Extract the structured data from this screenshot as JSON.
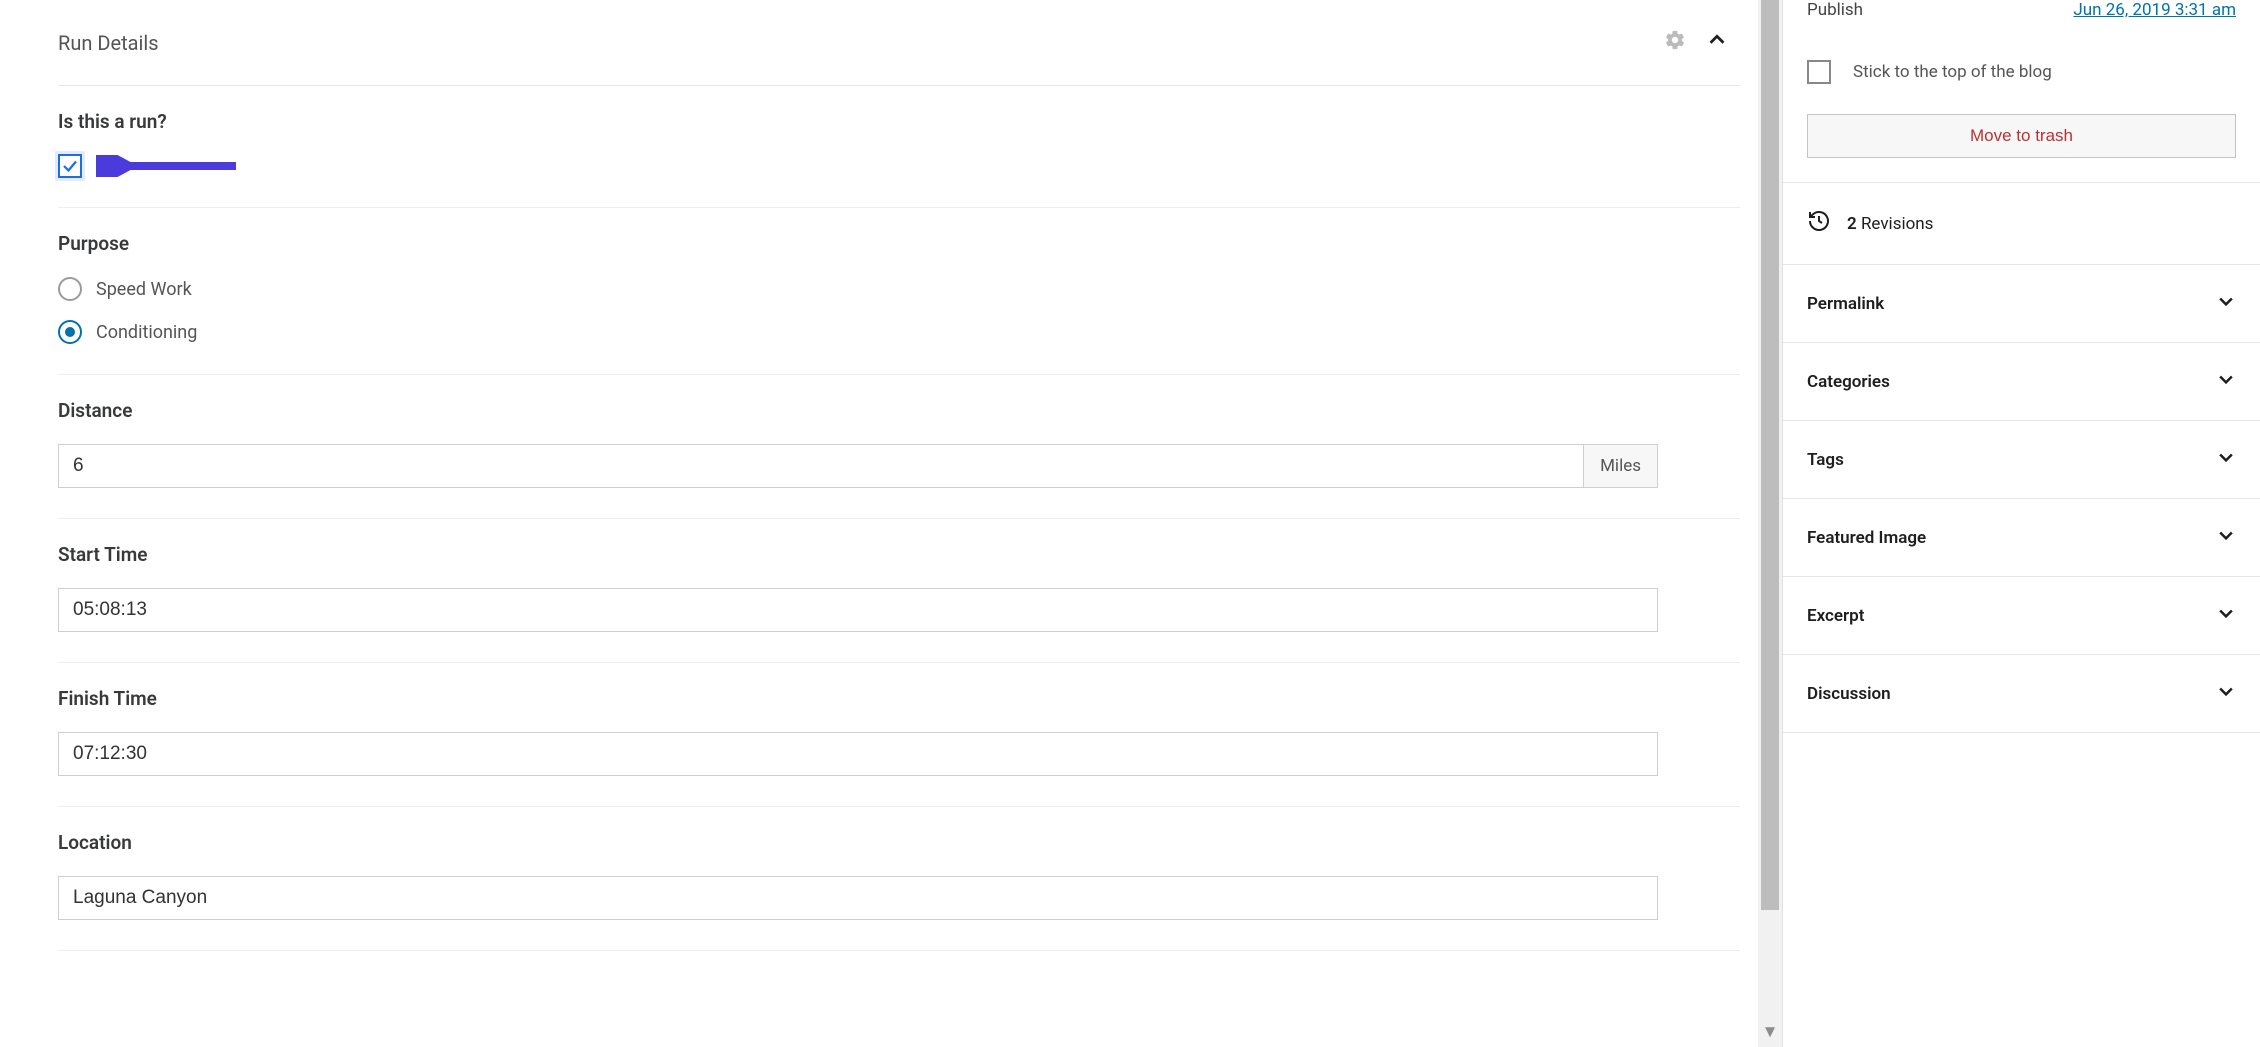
{
  "panel": {
    "title": "Run Details"
  },
  "fields": {
    "is_run": {
      "label": "Is this a run?",
      "checked": true
    },
    "purpose": {
      "label": "Purpose",
      "options": [
        {
          "label": "Speed Work",
          "selected": false
        },
        {
          "label": "Conditioning",
          "selected": true
        }
      ]
    },
    "distance": {
      "label": "Distance",
      "value": "6",
      "unit": "Miles"
    },
    "start_time": {
      "label": "Start Time",
      "value": "05:08:13"
    },
    "finish_time": {
      "label": "Finish Time",
      "value": "07:12:30"
    },
    "location": {
      "label": "Location",
      "value": "Laguna Canyon"
    }
  },
  "sidebar": {
    "publish": {
      "label": "Publish",
      "date": "Jun 26, 2019 3:31 am"
    },
    "stick_label": "Stick to the top of the blog",
    "trash_label": "Move to trash",
    "revisions": {
      "count": "2",
      "label": "Revisions"
    },
    "panels": [
      {
        "label": "Permalink"
      },
      {
        "label": "Categories"
      },
      {
        "label": "Tags"
      },
      {
        "label": "Featured Image"
      },
      {
        "label": "Excerpt"
      },
      {
        "label": "Discussion"
      }
    ]
  }
}
